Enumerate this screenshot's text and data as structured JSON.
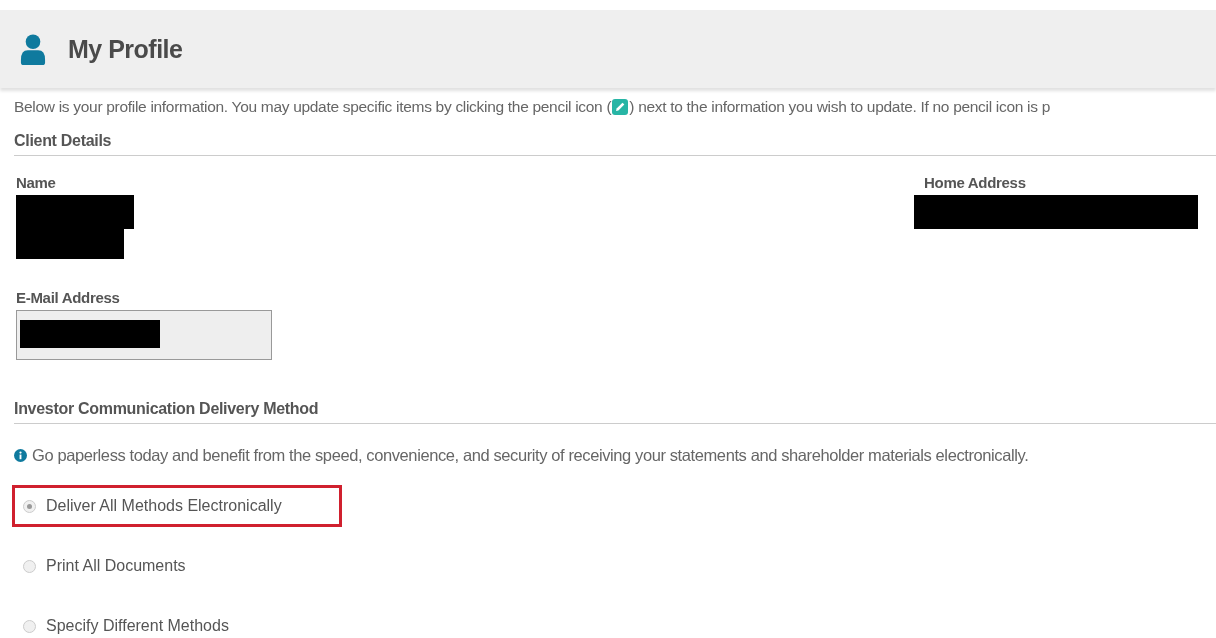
{
  "header": {
    "title": "My Profile"
  },
  "intro": {
    "before": "Below is your profile information. You may update specific items by clicking the pencil icon (",
    "after": ") next to the information you wish to update. If no pencil icon is p"
  },
  "client_details": {
    "heading": "Client Details",
    "name_label": "Name",
    "home_address_label": "Home Address",
    "email_label": "E-Mail Address"
  },
  "delivery": {
    "heading": "Investor Communication Delivery Method",
    "info": "Go paperless today and benefit from the speed, convenience, and security of receiving your statements and shareholder materials electronically.",
    "options": [
      {
        "label": "Deliver All Methods Electronically",
        "selected": true,
        "highlighted": true
      },
      {
        "label": "Print All Documents",
        "selected": false,
        "highlighted": false
      },
      {
        "label": "Specify Different Methods",
        "selected": false,
        "highlighted": false
      }
    ]
  }
}
